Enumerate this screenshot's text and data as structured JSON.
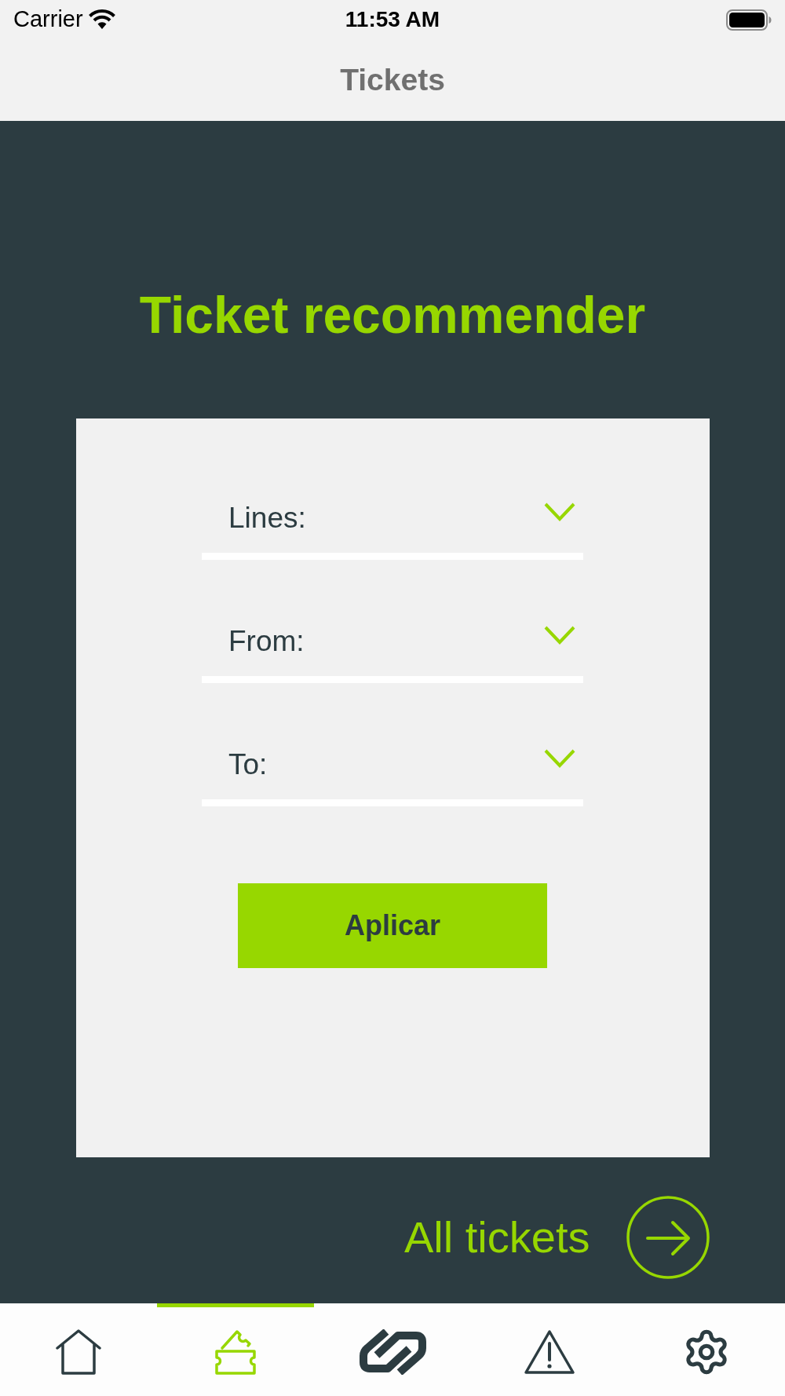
{
  "status_bar": {
    "carrier": "Carrier",
    "time": "11:53 AM"
  },
  "nav_bar": {
    "title": "Tickets"
  },
  "recommender": {
    "title": "Ticket recommender",
    "fields": [
      {
        "label": "Lines:"
      },
      {
        "label": "From:"
      },
      {
        "label": "To:"
      }
    ],
    "apply_button": "Aplicar"
  },
  "all_tickets_link": {
    "label": "All tickets"
  },
  "tab_bar": {
    "tabs": [
      {
        "kind": "home",
        "selected": false
      },
      {
        "kind": "tickets",
        "selected": true
      },
      {
        "kind": "link",
        "selected": false
      },
      {
        "kind": "warning",
        "selected": false
      },
      {
        "kind": "settings",
        "selected": false
      }
    ]
  }
}
